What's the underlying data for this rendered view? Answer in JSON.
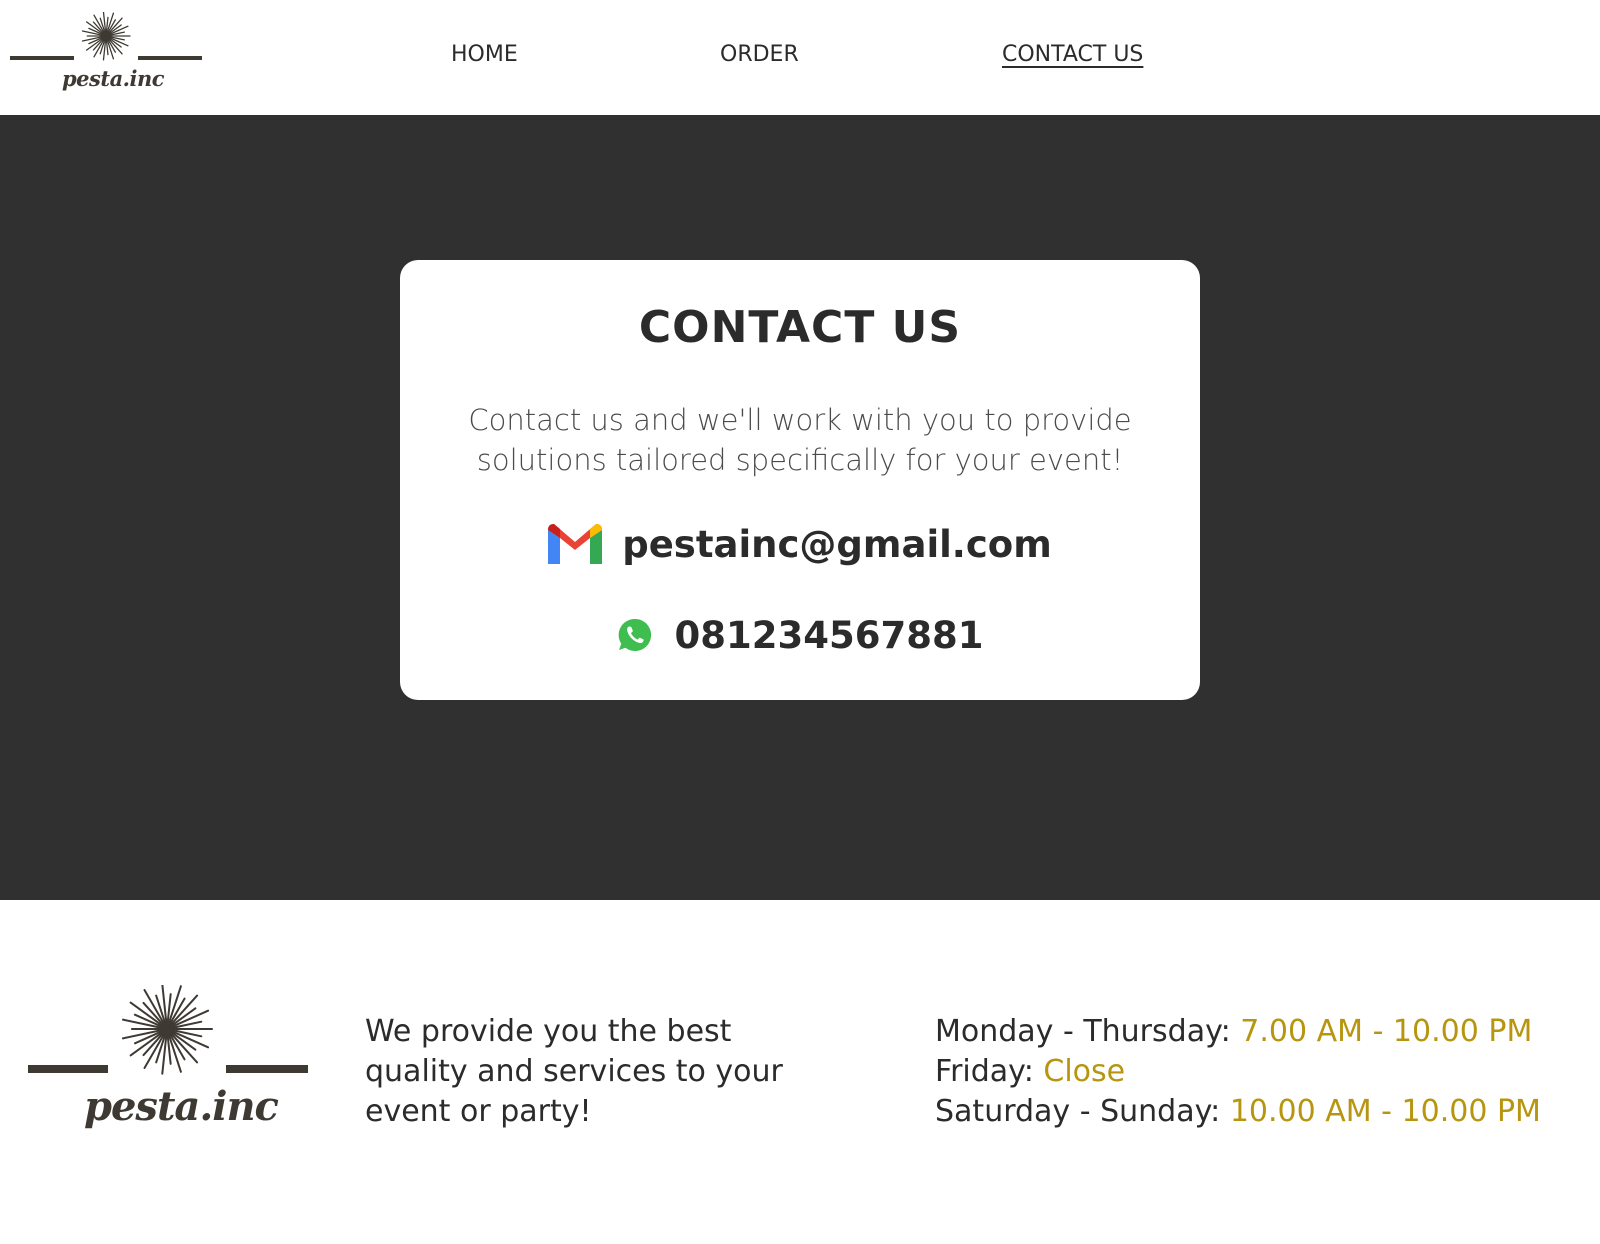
{
  "brand": {
    "name": "pesta.inc"
  },
  "nav": {
    "items": [
      {
        "label": "HOME"
      },
      {
        "label": "ORDER"
      },
      {
        "label": "CONTACT US"
      }
    ],
    "active": "CONTACT US"
  },
  "contact_card": {
    "title": "CONTACT US",
    "description": "Contact us and we'll work with you to provide solutions tailored specifically for your event!",
    "email": "pestainc@gmail.com",
    "email_icon": "gmail-icon",
    "phone": "081234567881",
    "phone_icon": "whatsapp-icon"
  },
  "footer": {
    "tagline": "We provide you the best quality and services to your event or party!",
    "hours": [
      {
        "day": "Monday - Thursday: ",
        "time": "7.00 AM - 10.00 PM"
      },
      {
        "day": "Friday: ",
        "time": "Close"
      },
      {
        "day": "Saturday - Sunday: ",
        "time": "10.00 AM - 10.00 PM"
      }
    ]
  },
  "colors": {
    "hero_background": "#303030",
    "card_background": "#ffffff",
    "text": "#2b2b2b",
    "accent_gold": "#b8950f",
    "logo_brown": "#3e3a33"
  }
}
